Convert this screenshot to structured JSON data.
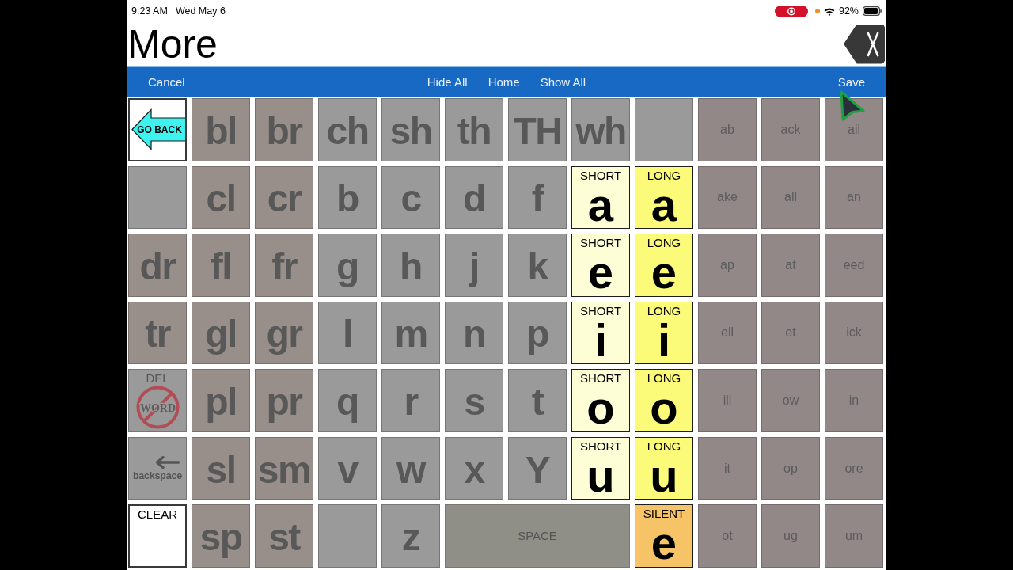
{
  "status_bar": {
    "time": "9:23 AM",
    "date": "Wed May 6",
    "battery": "92%"
  },
  "header": {
    "title": "More"
  },
  "toolbar": {
    "cancel": "Cancel",
    "actions": [
      "Hide All",
      "Home",
      "Show All"
    ],
    "save": "Save"
  },
  "grid": {
    "rows": [
      [
        {
          "kind": "nav",
          "label": "GO BACK"
        },
        {
          "kind": "blend",
          "text": "bl"
        },
        {
          "kind": "blend",
          "text": "br"
        },
        {
          "kind": "letter",
          "text": "ch"
        },
        {
          "kind": "letter",
          "text": "sh"
        },
        {
          "kind": "letter",
          "text": "th"
        },
        {
          "kind": "letter",
          "text": "TH"
        },
        {
          "kind": "letter",
          "text": "wh"
        },
        {
          "kind": "empty"
        },
        {
          "kind": "family",
          "text": "ab"
        },
        {
          "kind": "family",
          "text": "ack"
        },
        {
          "kind": "family",
          "text": "ail"
        }
      ],
      [
        {
          "kind": "empty"
        },
        {
          "kind": "blend",
          "text": "cl"
        },
        {
          "kind": "blend",
          "text": "cr"
        },
        {
          "kind": "letter",
          "text": "b"
        },
        {
          "kind": "letter",
          "text": "c"
        },
        {
          "kind": "letter",
          "text": "d"
        },
        {
          "kind": "letter",
          "text": "f"
        },
        {
          "kind": "short",
          "label": "SHORT",
          "text": "a"
        },
        {
          "kind": "long",
          "label": "LONG",
          "text": "a"
        },
        {
          "kind": "family",
          "text": "ake"
        },
        {
          "kind": "family",
          "text": "all"
        },
        {
          "kind": "family",
          "text": "an"
        }
      ],
      [
        {
          "kind": "blend",
          "text": "dr"
        },
        {
          "kind": "blend",
          "text": "fl"
        },
        {
          "kind": "blend",
          "text": "fr"
        },
        {
          "kind": "letter",
          "text": "g"
        },
        {
          "kind": "letter",
          "text": "h"
        },
        {
          "kind": "letter",
          "text": "j"
        },
        {
          "kind": "letter",
          "text": "k"
        },
        {
          "kind": "short",
          "label": "SHORT",
          "text": "e"
        },
        {
          "kind": "long",
          "label": "LONG",
          "text": "e"
        },
        {
          "kind": "family",
          "text": "ap"
        },
        {
          "kind": "family",
          "text": "at"
        },
        {
          "kind": "family",
          "text": "eed"
        }
      ],
      [
        {
          "kind": "blend",
          "text": "tr"
        },
        {
          "kind": "blend",
          "text": "gl"
        },
        {
          "kind": "blend",
          "text": "gr"
        },
        {
          "kind": "letter",
          "text": "l"
        },
        {
          "kind": "letter",
          "text": "m"
        },
        {
          "kind": "letter",
          "text": "n"
        },
        {
          "kind": "letter",
          "text": "p"
        },
        {
          "kind": "short",
          "label": "SHORT",
          "text": "i"
        },
        {
          "kind": "long",
          "label": "LONG",
          "text": "i"
        },
        {
          "kind": "family",
          "text": "ell"
        },
        {
          "kind": "family",
          "text": "et"
        },
        {
          "kind": "family",
          "text": "ick"
        }
      ],
      [
        {
          "kind": "delete",
          "label": "DEL",
          "sign": "WORD"
        },
        {
          "kind": "blend",
          "text": "pl"
        },
        {
          "kind": "blend",
          "text": "pr"
        },
        {
          "kind": "letter",
          "text": "q"
        },
        {
          "kind": "letter",
          "text": "r"
        },
        {
          "kind": "letter",
          "text": "s"
        },
        {
          "kind": "letter",
          "text": "t"
        },
        {
          "kind": "short",
          "label": "SHORT",
          "text": "o"
        },
        {
          "kind": "long",
          "label": "LONG",
          "text": "o"
        },
        {
          "kind": "family",
          "text": "ill"
        },
        {
          "kind": "family",
          "text": "ow"
        },
        {
          "kind": "family",
          "text": "in"
        }
      ],
      [
        {
          "kind": "backspace",
          "label": "backspace"
        },
        {
          "kind": "blend",
          "text": "sl"
        },
        {
          "kind": "blend",
          "text": "sm"
        },
        {
          "kind": "letter",
          "text": "v"
        },
        {
          "kind": "letter",
          "text": "w"
        },
        {
          "kind": "letter",
          "text": "x"
        },
        {
          "kind": "letter",
          "text": "Y"
        },
        {
          "kind": "short",
          "label": "SHORT",
          "text": "u"
        },
        {
          "kind": "long",
          "label": "LONG",
          "text": "u"
        },
        {
          "kind": "family",
          "text": "it"
        },
        {
          "kind": "family",
          "text": "op"
        },
        {
          "kind": "family",
          "text": "ore"
        }
      ],
      [
        {
          "kind": "clear",
          "label": "CLEAR"
        },
        {
          "kind": "blend",
          "text": "sp"
        },
        {
          "kind": "blend",
          "text": "st"
        },
        {
          "kind": "empty"
        },
        {
          "kind": "letter",
          "text": "z"
        },
        "",
        {
          "kind": "space",
          "label": "SPACE"
        },
        "",
        {
          "kind": "silent",
          "label": "SILENT",
          "text": "e"
        },
        {
          "kind": "family",
          "text": "ot"
        },
        {
          "kind": "family",
          "text": "ug"
        },
        {
          "kind": "family",
          "text": "um"
        }
      ]
    ]
  }
}
